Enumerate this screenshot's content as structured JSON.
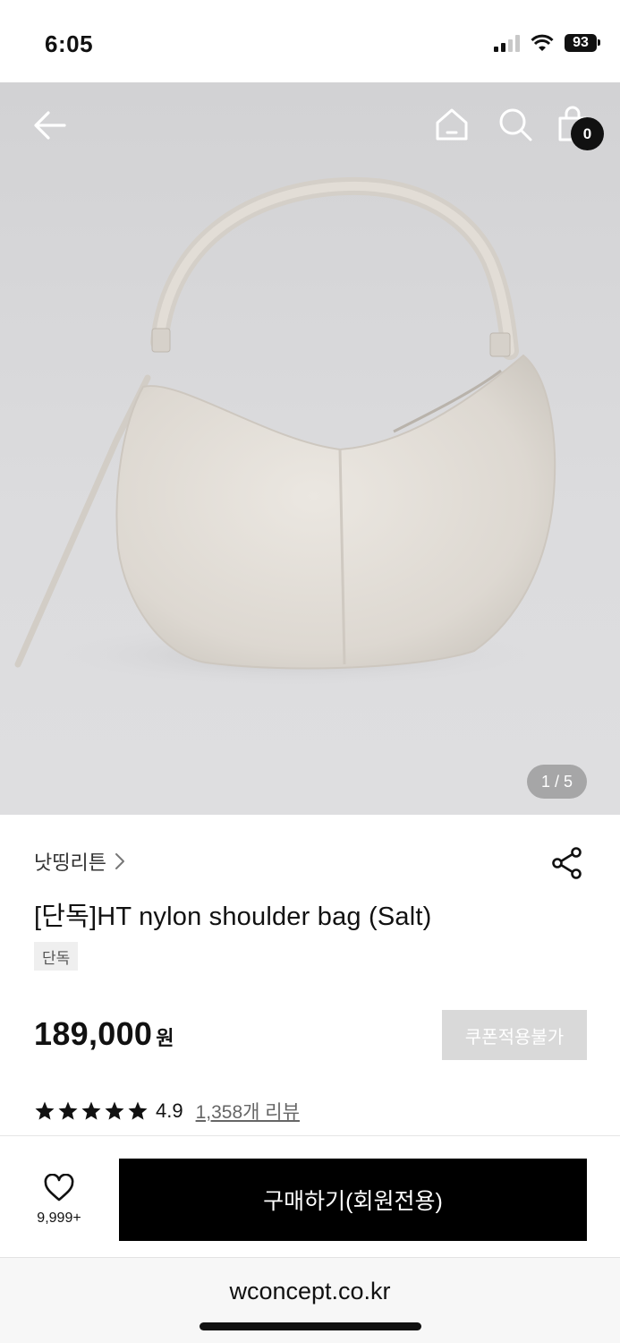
{
  "status_bar": {
    "time": "6:05",
    "battery": "93"
  },
  "header": {
    "cart_count": "0"
  },
  "gallery": {
    "page_indicator": "1 / 5"
  },
  "product": {
    "brand": "낫띵리튼",
    "title": "[단독]HT nylon shoulder bag (Salt)",
    "badge": "단독",
    "price": "189,000",
    "currency": "원",
    "coupon_label": "쿠폰적용불가",
    "rating": "4.9",
    "rating_stars": 5,
    "review_link": "1,358개 리뷰"
  },
  "bottom_bar": {
    "wish_count": "9,999+",
    "buy_label": "구매하기(회원전용)"
  },
  "browser": {
    "url": "wconcept.co.kr"
  },
  "icons": [
    "back-arrow-icon",
    "home-icon",
    "search-icon",
    "shopping-bag-icon",
    "chevron-right-icon",
    "share-icon",
    "star-icon",
    "heart-icon"
  ]
}
